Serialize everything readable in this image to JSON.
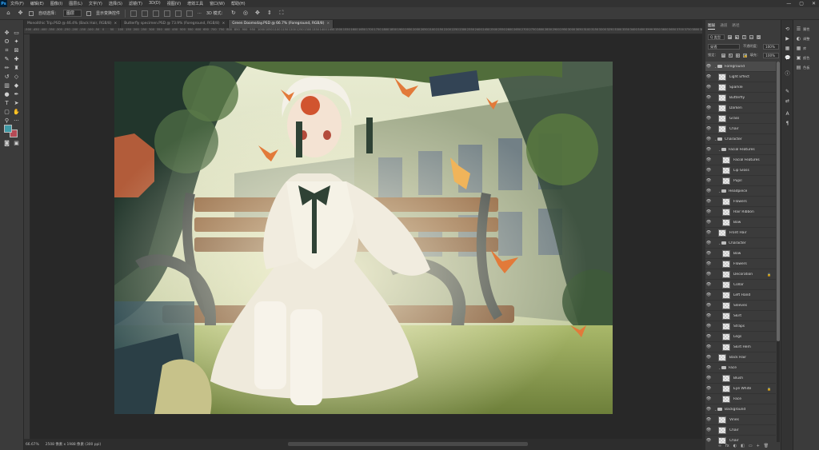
{
  "menu": {
    "app_logo": "Ps",
    "items": [
      "文件(F)",
      "编辑(E)",
      "图像(I)",
      "图层(L)",
      "文字(Y)",
      "选择(S)",
      "滤镜(T)",
      "3D(D)",
      "视图(V)",
      "增效工具",
      "窗口(W)",
      "帮助(H)"
    ],
    "window_controls": [
      "—",
      "▢",
      "✕"
    ]
  },
  "options": {
    "auto_select_label": "自动选择：",
    "auto_select_value": "图层",
    "show_transform_label": "显示变换控件",
    "more": "···",
    "mode_3d": "3D 模式："
  },
  "tabs": [
    {
      "label": "Monolithic Trip.PSD @ 46.4% (Back Hair, RGB/8)",
      "active": false
    },
    {
      "label": "Butterfly specimen.PSD @ 73.9% (Foreground, RGB/8)",
      "active": false
    },
    {
      "label": "Green Doomsday.PSD @ 66.7% (Foreground, RGB/8)",
      "active": true
    }
  ],
  "ruler": {
    "labels": [
      "-500",
      "-450",
      "-400",
      "-350",
      "-300",
      "-250",
      "-200",
      "-150",
      "-100",
      "-50",
      "0",
      "50",
      "100",
      "150",
      "200",
      "250",
      "300",
      "350",
      "400",
      "450",
      "500",
      "550",
      "600",
      "650",
      "700",
      "750",
      "800",
      "850",
      "900",
      "950",
      "1000",
      "1050",
      "1100",
      "1150",
      "1200",
      "1250",
      "1300",
      "1350",
      "1400",
      "1450",
      "1500",
      "1550",
      "1600",
      "1650",
      "1700",
      "1750",
      "1800",
      "1850",
      "1900",
      "1950",
      "2000",
      "2050",
      "2100",
      "2150",
      "2200",
      "2250",
      "2300",
      "2350",
      "2400",
      "2450",
      "2500",
      "2550",
      "2600",
      "2650",
      "2700",
      "2750",
      "2800",
      "2850",
      "2900",
      "2950",
      "3000",
      "3050",
      "3100",
      "3150",
      "3200",
      "3250",
      "3300",
      "3350",
      "3400",
      "3450",
      "3500",
      "3550",
      "3600",
      "3650",
      "3700",
      "3750",
      "3800",
      "3850"
    ]
  },
  "status": {
    "zoom": "66.67%",
    "doc_size": "2508 像素 x 1988 像素 (300 ppi)"
  },
  "layers_panel": {
    "tabs": [
      "图层",
      "通道",
      "路径"
    ],
    "kind_filter": "Q 类型",
    "blend_mode": "穿透",
    "opacity_label": "不透明度：",
    "opacity_value": "100%",
    "lock_label": "锁定：",
    "fill_label": "填充：",
    "fill_value": "100%",
    "layers": [
      {
        "name": "Foreground",
        "type": "group",
        "indent": 0,
        "selected": true
      },
      {
        "name": "Light Effect",
        "type": "layer",
        "indent": 1
      },
      {
        "name": "Sparkle",
        "type": "layer",
        "indent": 1
      },
      {
        "name": "Butterfly",
        "type": "layer",
        "indent": 1
      },
      {
        "name": "Darken",
        "type": "layer",
        "indent": 1
      },
      {
        "name": "Grass",
        "type": "layer",
        "indent": 1
      },
      {
        "name": "Chair",
        "type": "layer",
        "indent": 1
      },
      {
        "name": "Character",
        "type": "group",
        "indent": 0
      },
      {
        "name": "Facial Features",
        "type": "group",
        "indent": 1
      },
      {
        "name": "Facial Features",
        "type": "layer",
        "indent": 2
      },
      {
        "name": "Lip Gloss",
        "type": "layer",
        "indent": 2
      },
      {
        "name": "Pupil",
        "type": "layer",
        "indent": 2
      },
      {
        "name": "Headpiece",
        "type": "group",
        "indent": 1
      },
      {
        "name": "Flowers",
        "type": "layer",
        "indent": 2
      },
      {
        "name": "Hair Ribbon",
        "type": "layer",
        "indent": 2
      },
      {
        "name": "Bow",
        "type": "layer",
        "indent": 2
      },
      {
        "name": "Front Hair",
        "type": "layer",
        "indent": 1
      },
      {
        "name": "Character",
        "type": "group",
        "indent": 1
      },
      {
        "name": "Bow",
        "type": "layer",
        "indent": 2
      },
      {
        "name": "Flowers",
        "type": "layer",
        "indent": 2
      },
      {
        "name": "Decoration",
        "type": "layer",
        "indent": 2,
        "locked": true
      },
      {
        "name": "Collar",
        "type": "layer",
        "indent": 2
      },
      {
        "name": "Left Hand",
        "type": "layer",
        "indent": 2
      },
      {
        "name": "Sleeves",
        "type": "layer",
        "indent": 2
      },
      {
        "name": "Skirt",
        "type": "layer",
        "indent": 2
      },
      {
        "name": "Straps",
        "type": "layer",
        "indent": 2
      },
      {
        "name": "Legs",
        "type": "layer",
        "indent": 2
      },
      {
        "name": "Skirt Hem",
        "type": "layer",
        "indent": 2
      },
      {
        "name": "Back Hair",
        "type": "layer",
        "indent": 1
      },
      {
        "name": "Face",
        "type": "group",
        "indent": 1
      },
      {
        "name": "Blush",
        "type": "layer",
        "indent": 2
      },
      {
        "name": "Eye White",
        "type": "layer",
        "indent": 2,
        "locked": true
      },
      {
        "name": "Face",
        "type": "layer",
        "indent": 2
      },
      {
        "name": "Background",
        "type": "group",
        "indent": 0
      },
      {
        "name": "Vines",
        "type": "layer",
        "indent": 1
      },
      {
        "name": "Chair",
        "type": "layer",
        "indent": 1
      },
      {
        "name": "Chair",
        "type": "layer",
        "indent": 1
      }
    ],
    "footer_icons": [
      "∞",
      "fx",
      "◐",
      "◧",
      "▭",
      "+",
      "🗑"
    ]
  },
  "right_panels": [
    {
      "label": "属性",
      "icon": "☰"
    },
    {
      "label": "调整",
      "icon": "◐"
    },
    {
      "label": "库",
      "icon": "▦"
    },
    {
      "label": "颜色",
      "icon": "▣"
    },
    {
      "label": "色板",
      "icon": "▤"
    }
  ],
  "colors": {
    "foreground_swatch": "#3f9aa6",
    "background_swatch": "#b54a55",
    "accent": "#31a8ff"
  }
}
